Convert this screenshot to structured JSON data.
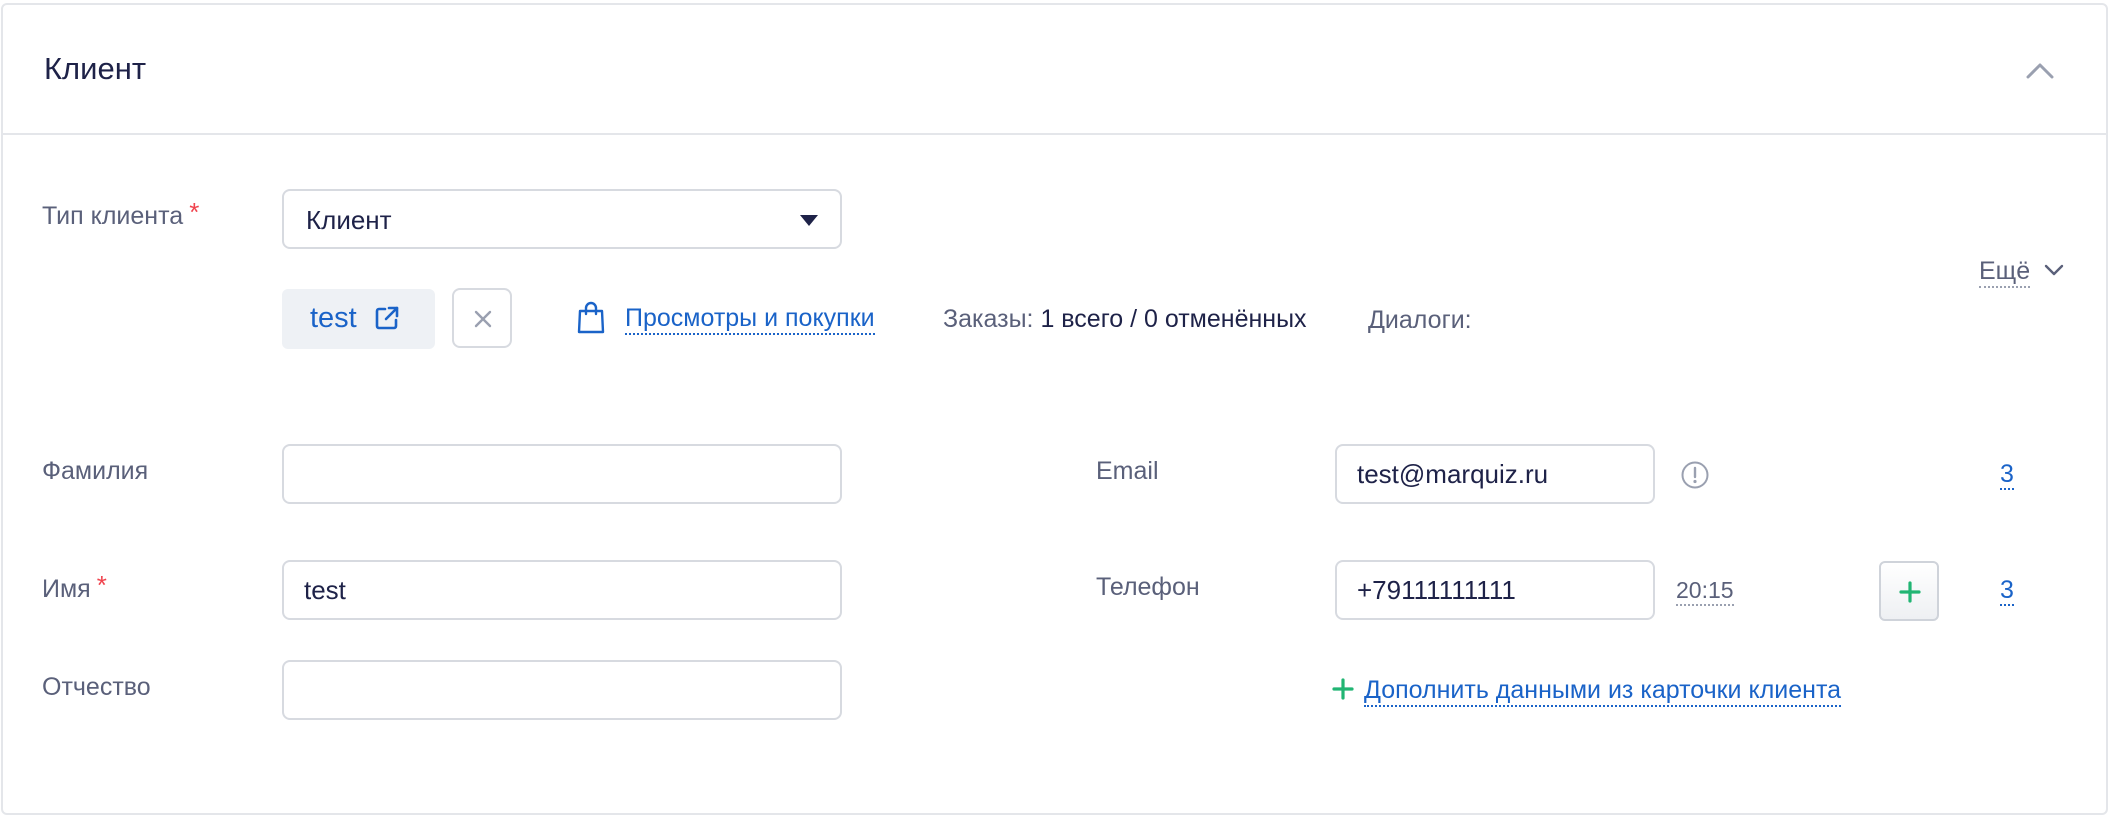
{
  "card": {
    "title": "Клиент"
  },
  "client_type": {
    "label": "Тип клиента",
    "required_mark": "*",
    "value": "Клиент"
  },
  "client_chip": {
    "name": "test"
  },
  "views_link": "Просмотры и покупки",
  "orders": {
    "label": "Заказы:",
    "value": "1 всего / 0 отменённых"
  },
  "dialogs": {
    "label": "Диалоги:"
  },
  "more": {
    "label": "Ещё"
  },
  "fields": {
    "last_name": {
      "label": "Фамилия",
      "value": ""
    },
    "first_name": {
      "label": "Имя",
      "required_mark": "*",
      "value": "test"
    },
    "middle_name": {
      "label": "Отчество",
      "value": ""
    },
    "email": {
      "label": "Email",
      "value": "test@marquiz.ru",
      "count": "3"
    },
    "phone": {
      "label": "Телефон",
      "value": "+79111111111",
      "time": "20:15",
      "count": "3"
    }
  },
  "fill_from_card_link": "Дополнить данными из карточки клиента",
  "colors": {
    "accent": "#1a63c8",
    "required": "#f0444e",
    "add_green": "#21b573",
    "border": "#d7dae0"
  }
}
